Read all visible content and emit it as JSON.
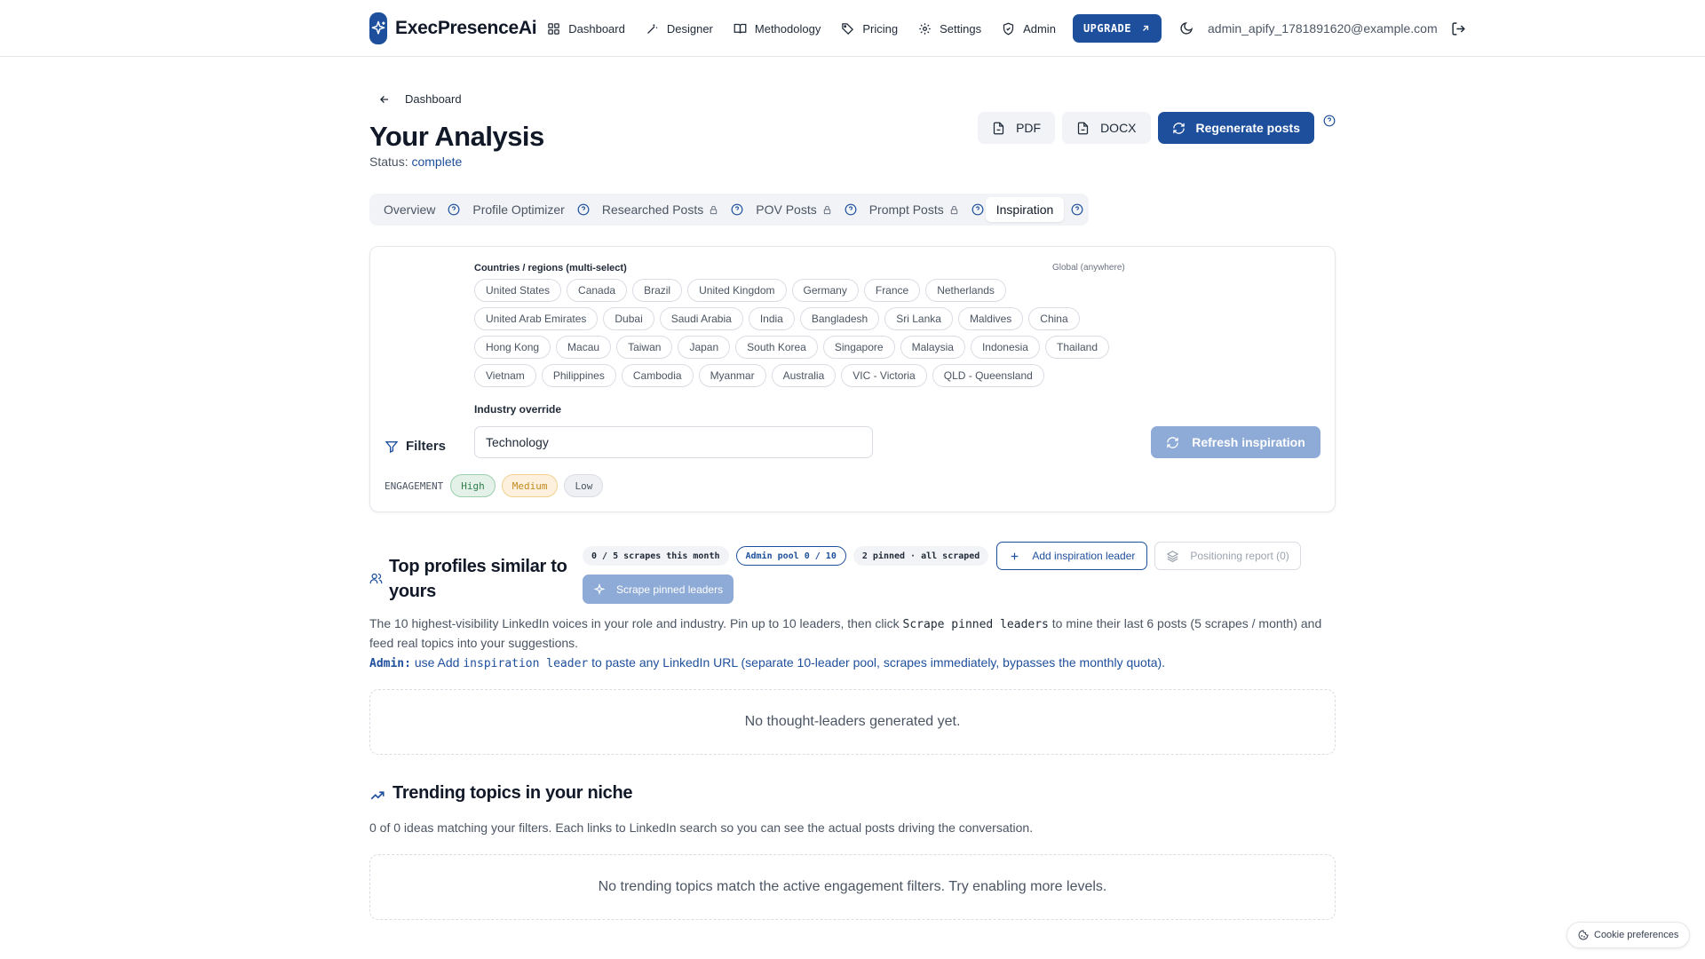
{
  "header": {
    "brand": "ExecPresenceAi",
    "nav": [
      {
        "label": "Dashboard",
        "icon": "grid-icon"
      },
      {
        "label": "Designer",
        "icon": "wand-icon"
      },
      {
        "label": "Methodology",
        "icon": "book-icon"
      },
      {
        "label": "Pricing",
        "icon": "tag-icon"
      },
      {
        "label": "Settings",
        "icon": "gear-icon"
      },
      {
        "label": "Admin",
        "icon": "shield-icon"
      }
    ],
    "upgrade": "UPGRADE",
    "email": "admin_apify_1781891620@example.com"
  },
  "page": {
    "back": "Dashboard",
    "title": "Your Analysis",
    "status_label": "Status:",
    "status_value": "complete",
    "pdf": "PDF",
    "docx": "DOCX",
    "regenerate": "Regenerate posts"
  },
  "tabs": [
    {
      "label": "Overview",
      "locked": false,
      "active": false
    },
    {
      "label": "Profile Optimizer",
      "locked": false,
      "active": false
    },
    {
      "label": "Researched Posts",
      "locked": true,
      "active": false
    },
    {
      "label": "POV Posts",
      "locked": true,
      "active": false
    },
    {
      "label": "Prompt Posts",
      "locked": true,
      "active": false
    },
    {
      "label": "Inspiration",
      "locked": false,
      "active": true
    }
  ],
  "filters": {
    "countries_label": "Countries / regions (multi-select)",
    "global_label": "Global (anywhere)",
    "countries": [
      [
        "United States",
        "Canada",
        "Brazil",
        "United Kingdom",
        "Germany",
        "France",
        "Netherlands"
      ],
      [
        "United Arab Emirates",
        "Dubai",
        "Saudi Arabia",
        "India",
        "Bangladesh",
        "Sri Lanka",
        "Maldives",
        "China"
      ],
      [
        "Hong Kong",
        "Macau",
        "Taiwan",
        "Japan",
        "South Korea",
        "Singapore",
        "Malaysia",
        "Indonesia",
        "Thailand"
      ],
      [
        "Vietnam",
        "Philippines",
        "Cambodia",
        "Myanmar",
        "Australia",
        "VIC - Victoria",
        "QLD - Queensland"
      ]
    ],
    "industry_label": "Industry override",
    "industry_value": "Technology",
    "title": "Filters",
    "refresh": "Refresh inspiration",
    "engagement_label": "ENGAGEMENT",
    "engagement": {
      "high": "High",
      "medium": "Medium",
      "low": "Low"
    }
  },
  "profiles": {
    "title": "Top profiles similar to yours",
    "scrapes": "0 / 5 scrapes this month",
    "admin_pool": "Admin pool 0 / 10",
    "pinned": "2 pinned · all scraped",
    "add_leader": "Add inspiration leader",
    "positioning": "Positioning report (0)",
    "scrape_btn": "Scrape pinned leaders",
    "desc_a": "The 10 highest-visibility LinkedIn voices in your role and industry. Pin up to 10 leaders, then click ",
    "desc_code": "Scrape pinned leaders",
    "desc_b": " to mine their last 6 posts (5 scrapes / month) and feed real topics into your suggestions.",
    "admin_label": "Admin:",
    "admin_a": " use Add ",
    "admin_code": "inspiration leader",
    "admin_b": " to paste any LinkedIn URL (separate 10-leader pool, scrapes immediately, bypasses the monthly quota).",
    "empty": "No thought-leaders generated yet."
  },
  "trending": {
    "title": "Trending topics in your niche",
    "desc": "0 of 0 ideas matching your filters. Each links to LinkedIn search so you can see the actual posts driving the conversation.",
    "empty": "No trending topics match the active engagement filters. Try enabling more levels."
  },
  "cookie": "Cookie preferences",
  "colors": {
    "brand": "#1e4f9c",
    "brand_disabled": "#8eaad6"
  }
}
